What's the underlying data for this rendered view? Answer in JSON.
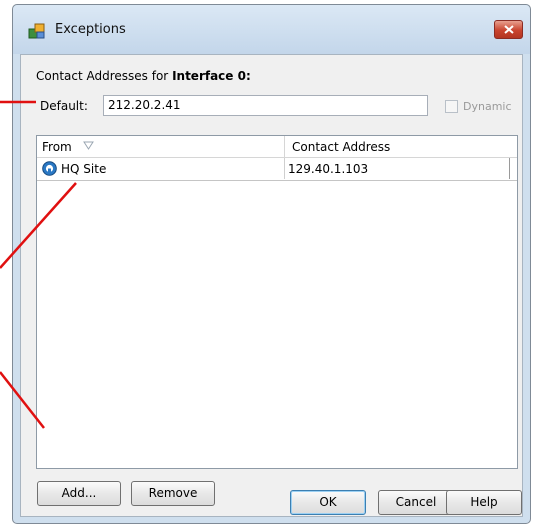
{
  "window": {
    "title": "Exceptions",
    "icon": "network-elements-icon"
  },
  "heading": {
    "prefix": "Contact Addresses for ",
    "interface": "Interface 0:"
  },
  "default": {
    "label": "Default:",
    "value": "212.20.2.41"
  },
  "dynamic": {
    "label": "Dynamic",
    "checked": false,
    "enabled": false
  },
  "table": {
    "columns": [
      "From",
      "Contact Address"
    ],
    "rows": [
      {
        "from": "HQ Site",
        "contact": "129.40.1.103",
        "icon": "site-icon"
      }
    ]
  },
  "buttons": {
    "add": "Add...",
    "remove": "Remove",
    "ok": "OK",
    "cancel": "Cancel",
    "help": "Help"
  },
  "colors": {
    "annotation": "#e01010",
    "title_bar": "#c3d6ea",
    "close_button": "#c9442f"
  }
}
